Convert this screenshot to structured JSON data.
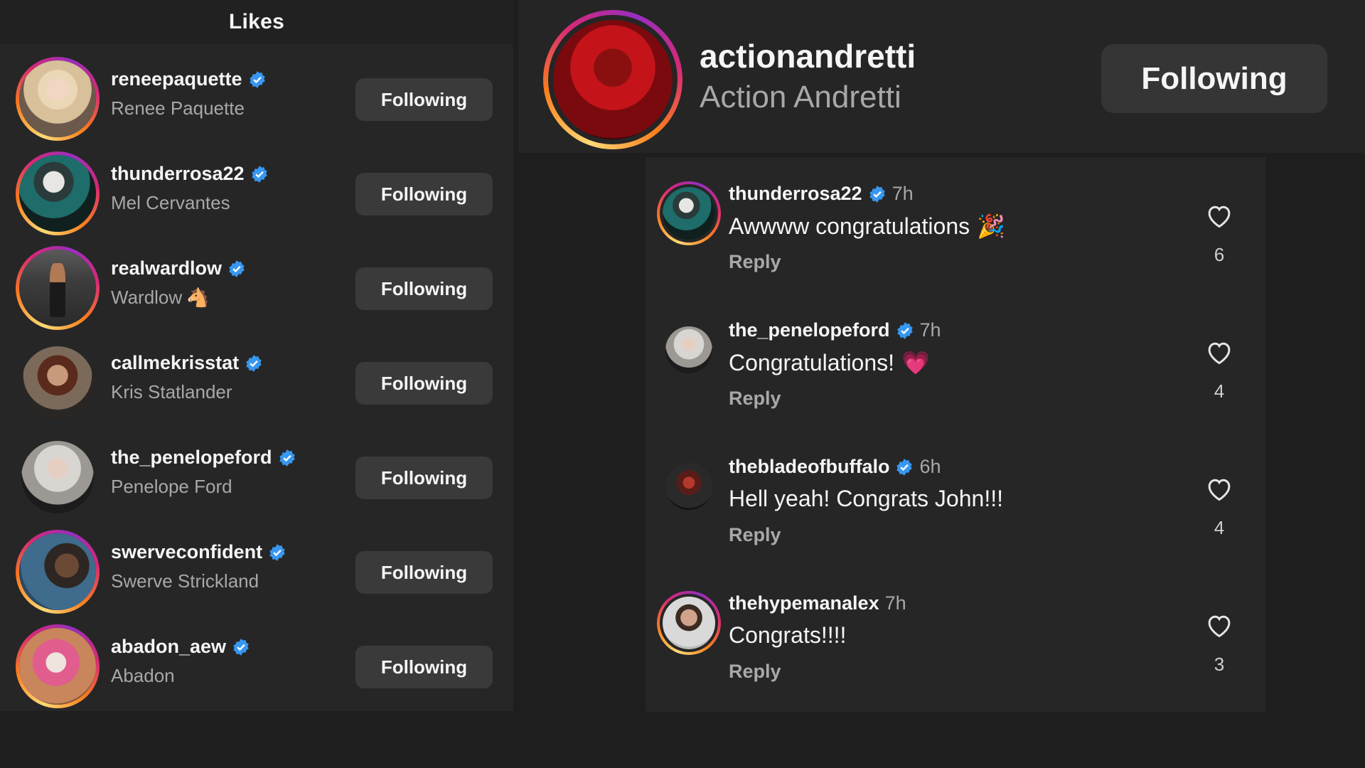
{
  "likes": {
    "title": "Likes",
    "users": [
      {
        "username": "reneepaquette",
        "name": "Renee Paquette",
        "button": "Following"
      },
      {
        "username": "thunderrosa22",
        "name": "Mel Cervantes",
        "button": "Following"
      },
      {
        "username": "realwardlow",
        "name": "Wardlow",
        "button": "Following"
      },
      {
        "username": "callmekrisstat",
        "name": "Kris Statlander",
        "button": "Following"
      },
      {
        "username": "the_penelopeford",
        "name": "Penelope Ford",
        "button": "Following"
      },
      {
        "username": "swerveconfident",
        "name": "Swerve Strickland",
        "button": "Following"
      },
      {
        "username": "abadon_aew",
        "name": "Abadon",
        "button": "Following"
      }
    ]
  },
  "profile": {
    "username": "actionandretti",
    "name": "Action Andretti",
    "button": "Following"
  },
  "comments": [
    {
      "username": "thunderrosa22",
      "time": "7h",
      "text": "Awwww congratulations",
      "reply": "Reply",
      "likes": "6"
    },
    {
      "username": "the_penelopeford",
      "time": "7h",
      "text": "Congratulations!",
      "reply": "Reply",
      "likes": "4"
    },
    {
      "username": "thebladeofbuffalo",
      "time": "6h",
      "text": "Hell yeah! Congrats John!!!",
      "reply": "Reply",
      "likes": "4"
    },
    {
      "username": "thehypemanalex",
      "time": "7h",
      "text": "Congrats!!!!",
      "reply": "Reply",
      "likes": "3"
    }
  ],
  "colors": {
    "background": "#1e1e1f",
    "panel": "#262626",
    "button": "#3a3a3a",
    "verified": "#3897f0",
    "muted_text": "#a8a8a8"
  },
  "icons": [
    "verified-badge-icon",
    "heart-outline-icon",
    "party-popper-emoji",
    "pink-heart-emoji",
    "horse-emoji"
  ]
}
